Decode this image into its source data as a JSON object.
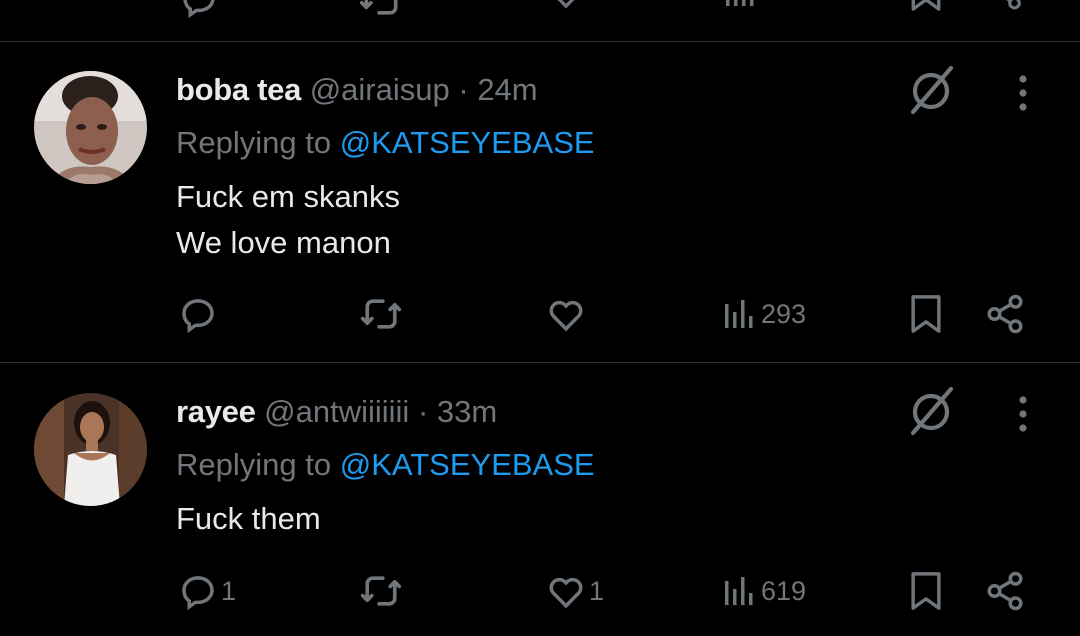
{
  "colors": {
    "background": "#000000",
    "text": "#e7e9ea",
    "muted": "#71767b",
    "link": "#1d9bf0",
    "divider": "#2f3336"
  },
  "tweets": [
    {
      "display_name": "boba tea",
      "handle": "@airaisup",
      "dot": "·",
      "time": "24m",
      "replying_prefix": "Replying to",
      "replying_to": "@KATSEYEBASE",
      "lines": [
        "Fuck em skanks",
        "We love manon"
      ],
      "reply_count": "",
      "retweet_count": "",
      "like_count": "",
      "views": "293",
      "icons": [
        "avatar",
        "grok-icon",
        "more-icon",
        "reply-icon",
        "retweet-icon",
        "like-icon",
        "views-icon",
        "bookmark-icon",
        "share-icon"
      ]
    },
    {
      "display_name": "rayee",
      "handle": "@antwiiiiiii",
      "dot": "·",
      "time": "33m",
      "replying_prefix": "Replying to",
      "replying_to": "@KATSEYEBASE",
      "lines": [
        "Fuck them"
      ],
      "reply_count": "1",
      "retweet_count": "",
      "like_count": "1",
      "views": "619",
      "icons": [
        "avatar",
        "grok-icon",
        "more-icon",
        "reply-icon",
        "retweet-icon",
        "like-icon",
        "views-icon",
        "bookmark-icon",
        "share-icon"
      ]
    }
  ]
}
